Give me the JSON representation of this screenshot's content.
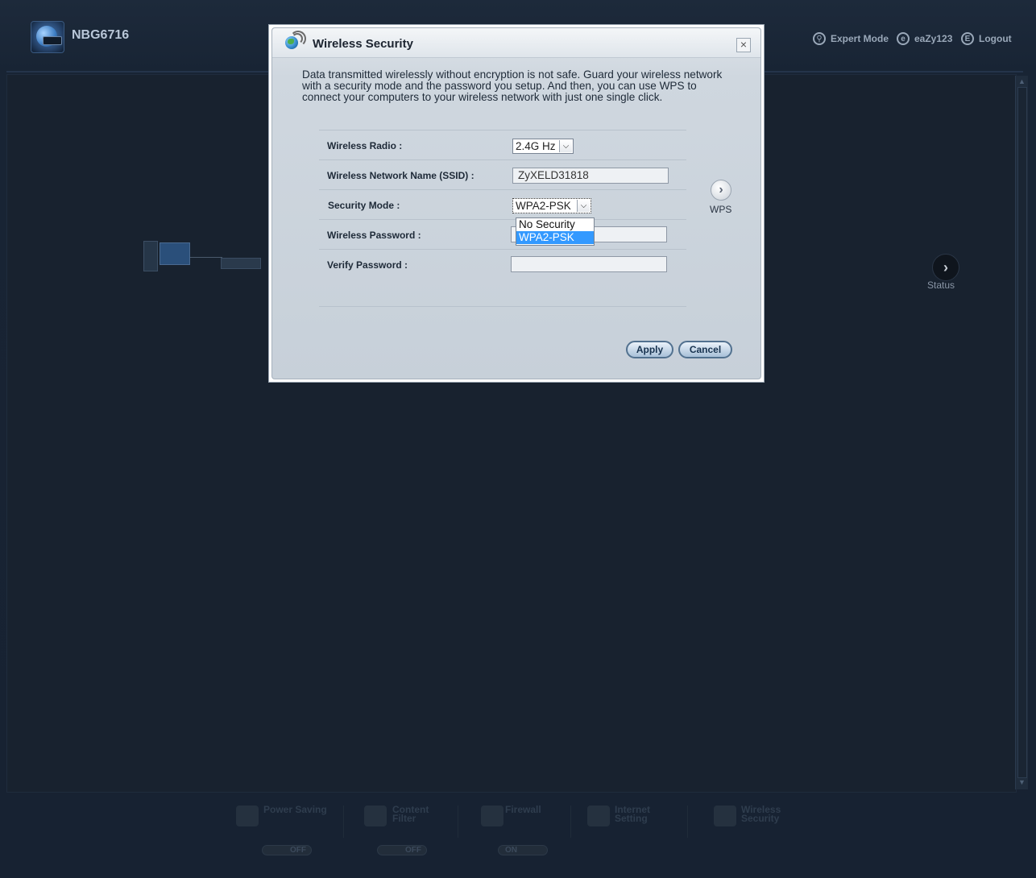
{
  "header": {
    "model": "NBG6716",
    "nav": [
      {
        "label": "Expert Mode",
        "icon": "wrench-icon"
      },
      {
        "label": "eaZy123",
        "icon": "eazy-icon"
      },
      {
        "label": "Logout",
        "icon": "logout-icon"
      }
    ]
  },
  "background": {
    "status_label": "Status",
    "bottom_bar": [
      {
        "label": "Power Saving",
        "toggle": "OFF"
      },
      {
        "label": "Content Filter",
        "toggle": "OFF"
      },
      {
        "label": "Firewall",
        "toggle": "ON"
      },
      {
        "label": "Internet Setting"
      },
      {
        "label": "Wireless Security"
      }
    ]
  },
  "dialog": {
    "title": "Wireless Security",
    "close_glyph": "×",
    "description": "Data transmitted wirelessly without encryption is not safe. Guard your wireless network with a security mode and the password you setup. And then, you can use WPS to connect your computers to your wireless network with just one single click.",
    "fields": {
      "wireless_radio": {
        "label": "Wireless Radio :",
        "value": "2.4G Hz"
      },
      "ssid": {
        "label": "Wireless Network Name (SSID) :",
        "value": "ZyXELD31818"
      },
      "security_mode": {
        "label": "Security Mode :",
        "value": "WPA2-PSK",
        "options": [
          "No Security",
          "WPA2-PSK"
        ]
      },
      "password": {
        "label": "Wireless Password :",
        "value": ""
      },
      "verify_password": {
        "label": "Verify Password :",
        "value": ""
      }
    },
    "wps_label": "WPS",
    "apply_label": "Apply",
    "cancel_label": "Cancel"
  },
  "colors": {
    "page_bg": "#1a2636",
    "dialog_bg": "#cfd7df",
    "selection": "#3399ff",
    "button_border": "#52718f"
  }
}
